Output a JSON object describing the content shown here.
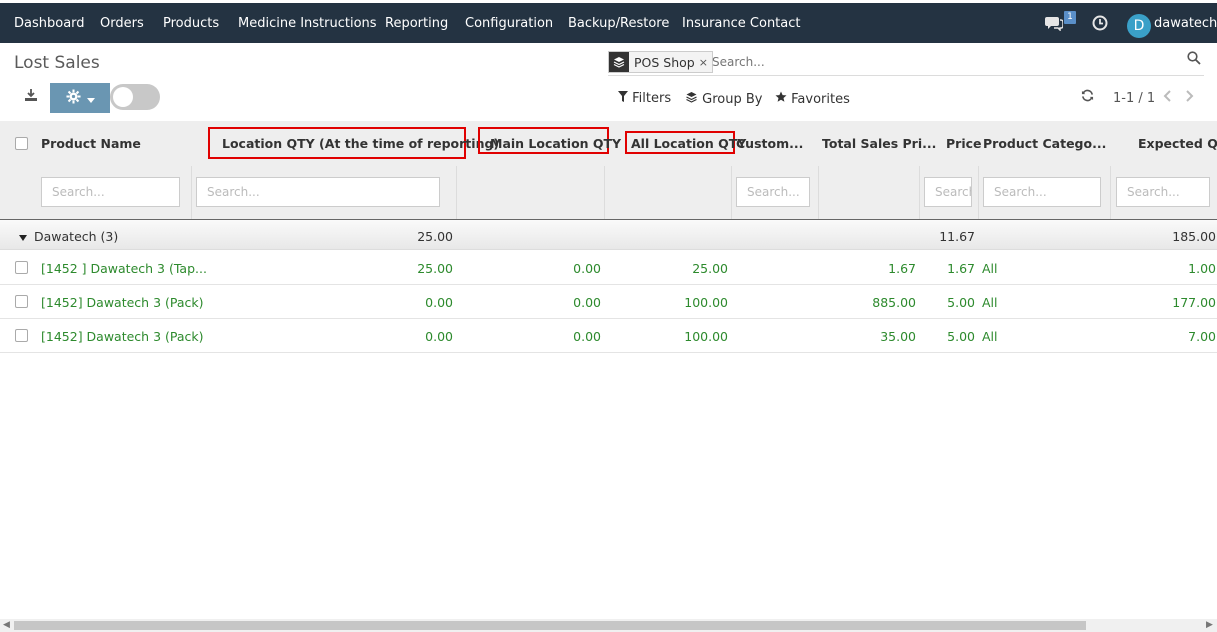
{
  "nav": {
    "items": [
      "Dashboard",
      "Orders",
      "Products",
      "Medicine Instructions",
      "Reporting",
      "Configuration",
      "Backup/Restore",
      "Insurance Contact"
    ],
    "messages_badge": "1",
    "avatar_letter": "D",
    "username": "dawatech"
  },
  "page": {
    "title": "Lost Sales"
  },
  "search": {
    "facet_label": "POS Shop",
    "facet_remove": "×",
    "placeholder": "Search..."
  },
  "controls": {
    "filters": "Filters",
    "group_by": "Group By",
    "favorites": "Favorites",
    "pager": "1-1 / 1"
  },
  "table": {
    "headers": {
      "product_name": "Product Name",
      "location_qty": "Location QTY (At the time of reporting)",
      "main_location_qty": "Main Location QTY",
      "all_location_qty": "All Location QTY",
      "customer": "Custom...",
      "total_sales_price": "Total Sales Pri...",
      "price": "Price",
      "product_category": "Product Catego...",
      "expected_qty": "Expected Q..."
    },
    "filter_placeholders": {
      "product": "Search...",
      "location": "Search...",
      "customer": "Search...",
      "price": "Search...",
      "category": "Search...",
      "expected": "Search..."
    },
    "group": {
      "label": "Dawatech (3)",
      "location_qty": "25.00",
      "price": "11.67",
      "expected_qty": "185.00"
    },
    "rows": [
      {
        "product": "[1452 ] Dawatech 3 (Tap...",
        "location_qty": "25.00",
        "main_location_qty": "0.00",
        "all_location_qty": "25.00",
        "total_sales_price": "1.67",
        "price": "1.67",
        "category": "All",
        "expected_qty": "1.00"
      },
      {
        "product": "[1452] Dawatech 3 (Pack)",
        "location_qty": "0.00",
        "main_location_qty": "0.00",
        "all_location_qty": "100.00",
        "total_sales_price": "885.00",
        "price": "5.00",
        "category": "All",
        "expected_qty": "177.00"
      },
      {
        "product": "[1452] Dawatech 3 (Pack)",
        "location_qty": "0.00",
        "main_location_qty": "0.00",
        "all_location_qty": "100.00",
        "total_sales_price": "35.00",
        "price": "5.00",
        "category": "All",
        "expected_qty": "7.00"
      }
    ]
  },
  "icons": {
    "chat": "chat-icon",
    "clock": "clock-icon",
    "search": "search-icon",
    "download": "download-icon",
    "gear": "gear-icon",
    "filter": "filter-icon",
    "layers": "layers-icon",
    "star": "star-icon",
    "refresh": "refresh-icon",
    "caret": "caret-down-icon"
  },
  "colors": {
    "navbar": "#243342",
    "link_green": "#2d8a2d",
    "highlight_red": "#e00000",
    "action_button": "#6a96b2"
  }
}
